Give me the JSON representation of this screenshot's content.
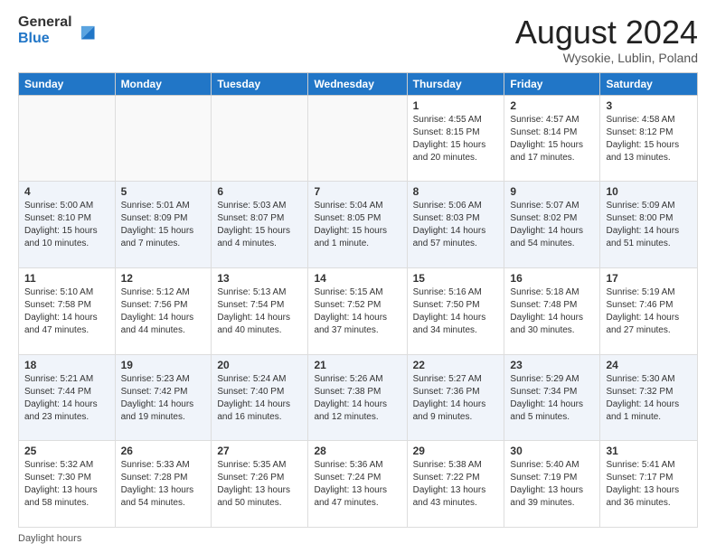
{
  "logo": {
    "general": "General",
    "blue": "Blue"
  },
  "title": "August 2024",
  "location": "Wysokie, Lublin, Poland",
  "days_header": [
    "Sunday",
    "Monday",
    "Tuesday",
    "Wednesday",
    "Thursday",
    "Friday",
    "Saturday"
  ],
  "footer_text": "Daylight hours",
  "weeks": [
    [
      {
        "num": "",
        "info": ""
      },
      {
        "num": "",
        "info": ""
      },
      {
        "num": "",
        "info": ""
      },
      {
        "num": "",
        "info": ""
      },
      {
        "num": "1",
        "info": "Sunrise: 4:55 AM\nSunset: 8:15 PM\nDaylight: 15 hours\nand 20 minutes."
      },
      {
        "num": "2",
        "info": "Sunrise: 4:57 AM\nSunset: 8:14 PM\nDaylight: 15 hours\nand 17 minutes."
      },
      {
        "num": "3",
        "info": "Sunrise: 4:58 AM\nSunset: 8:12 PM\nDaylight: 15 hours\nand 13 minutes."
      }
    ],
    [
      {
        "num": "4",
        "info": "Sunrise: 5:00 AM\nSunset: 8:10 PM\nDaylight: 15 hours\nand 10 minutes."
      },
      {
        "num": "5",
        "info": "Sunrise: 5:01 AM\nSunset: 8:09 PM\nDaylight: 15 hours\nand 7 minutes."
      },
      {
        "num": "6",
        "info": "Sunrise: 5:03 AM\nSunset: 8:07 PM\nDaylight: 15 hours\nand 4 minutes."
      },
      {
        "num": "7",
        "info": "Sunrise: 5:04 AM\nSunset: 8:05 PM\nDaylight: 15 hours\nand 1 minute."
      },
      {
        "num": "8",
        "info": "Sunrise: 5:06 AM\nSunset: 8:03 PM\nDaylight: 14 hours\nand 57 minutes."
      },
      {
        "num": "9",
        "info": "Sunrise: 5:07 AM\nSunset: 8:02 PM\nDaylight: 14 hours\nand 54 minutes."
      },
      {
        "num": "10",
        "info": "Sunrise: 5:09 AM\nSunset: 8:00 PM\nDaylight: 14 hours\nand 51 minutes."
      }
    ],
    [
      {
        "num": "11",
        "info": "Sunrise: 5:10 AM\nSunset: 7:58 PM\nDaylight: 14 hours\nand 47 minutes."
      },
      {
        "num": "12",
        "info": "Sunrise: 5:12 AM\nSunset: 7:56 PM\nDaylight: 14 hours\nand 44 minutes."
      },
      {
        "num": "13",
        "info": "Sunrise: 5:13 AM\nSunset: 7:54 PM\nDaylight: 14 hours\nand 40 minutes."
      },
      {
        "num": "14",
        "info": "Sunrise: 5:15 AM\nSunset: 7:52 PM\nDaylight: 14 hours\nand 37 minutes."
      },
      {
        "num": "15",
        "info": "Sunrise: 5:16 AM\nSunset: 7:50 PM\nDaylight: 14 hours\nand 34 minutes."
      },
      {
        "num": "16",
        "info": "Sunrise: 5:18 AM\nSunset: 7:48 PM\nDaylight: 14 hours\nand 30 minutes."
      },
      {
        "num": "17",
        "info": "Sunrise: 5:19 AM\nSunset: 7:46 PM\nDaylight: 14 hours\nand 27 minutes."
      }
    ],
    [
      {
        "num": "18",
        "info": "Sunrise: 5:21 AM\nSunset: 7:44 PM\nDaylight: 14 hours\nand 23 minutes."
      },
      {
        "num": "19",
        "info": "Sunrise: 5:23 AM\nSunset: 7:42 PM\nDaylight: 14 hours\nand 19 minutes."
      },
      {
        "num": "20",
        "info": "Sunrise: 5:24 AM\nSunset: 7:40 PM\nDaylight: 14 hours\nand 16 minutes."
      },
      {
        "num": "21",
        "info": "Sunrise: 5:26 AM\nSunset: 7:38 PM\nDaylight: 14 hours\nand 12 minutes."
      },
      {
        "num": "22",
        "info": "Sunrise: 5:27 AM\nSunset: 7:36 PM\nDaylight: 14 hours\nand 9 minutes."
      },
      {
        "num": "23",
        "info": "Sunrise: 5:29 AM\nSunset: 7:34 PM\nDaylight: 14 hours\nand 5 minutes."
      },
      {
        "num": "24",
        "info": "Sunrise: 5:30 AM\nSunset: 7:32 PM\nDaylight: 14 hours\nand 1 minute."
      }
    ],
    [
      {
        "num": "25",
        "info": "Sunrise: 5:32 AM\nSunset: 7:30 PM\nDaylight: 13 hours\nand 58 minutes."
      },
      {
        "num": "26",
        "info": "Sunrise: 5:33 AM\nSunset: 7:28 PM\nDaylight: 13 hours\nand 54 minutes."
      },
      {
        "num": "27",
        "info": "Sunrise: 5:35 AM\nSunset: 7:26 PM\nDaylight: 13 hours\nand 50 minutes."
      },
      {
        "num": "28",
        "info": "Sunrise: 5:36 AM\nSunset: 7:24 PM\nDaylight: 13 hours\nand 47 minutes."
      },
      {
        "num": "29",
        "info": "Sunrise: 5:38 AM\nSunset: 7:22 PM\nDaylight: 13 hours\nand 43 minutes."
      },
      {
        "num": "30",
        "info": "Sunrise: 5:40 AM\nSunset: 7:19 PM\nDaylight: 13 hours\nand 39 minutes."
      },
      {
        "num": "31",
        "info": "Sunrise: 5:41 AM\nSunset: 7:17 PM\nDaylight: 13 hours\nand 36 minutes."
      }
    ]
  ]
}
